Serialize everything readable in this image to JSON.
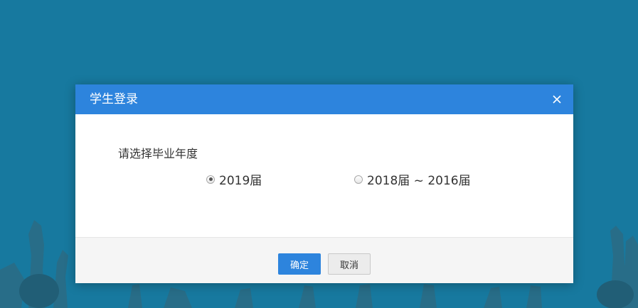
{
  "dialog": {
    "title": "学生登录",
    "close_icon": "close-icon",
    "prompt": "请选择毕业年度",
    "options": [
      {
        "label": "2019届",
        "checked": true
      },
      {
        "label": "2018届 ~ 2016届",
        "checked": false
      }
    ],
    "confirm_label": "确定",
    "cancel_label": "取消"
  },
  "colors": {
    "background": "#17799f",
    "header": "#2d84dd",
    "primary_button": "#2d84dd"
  }
}
